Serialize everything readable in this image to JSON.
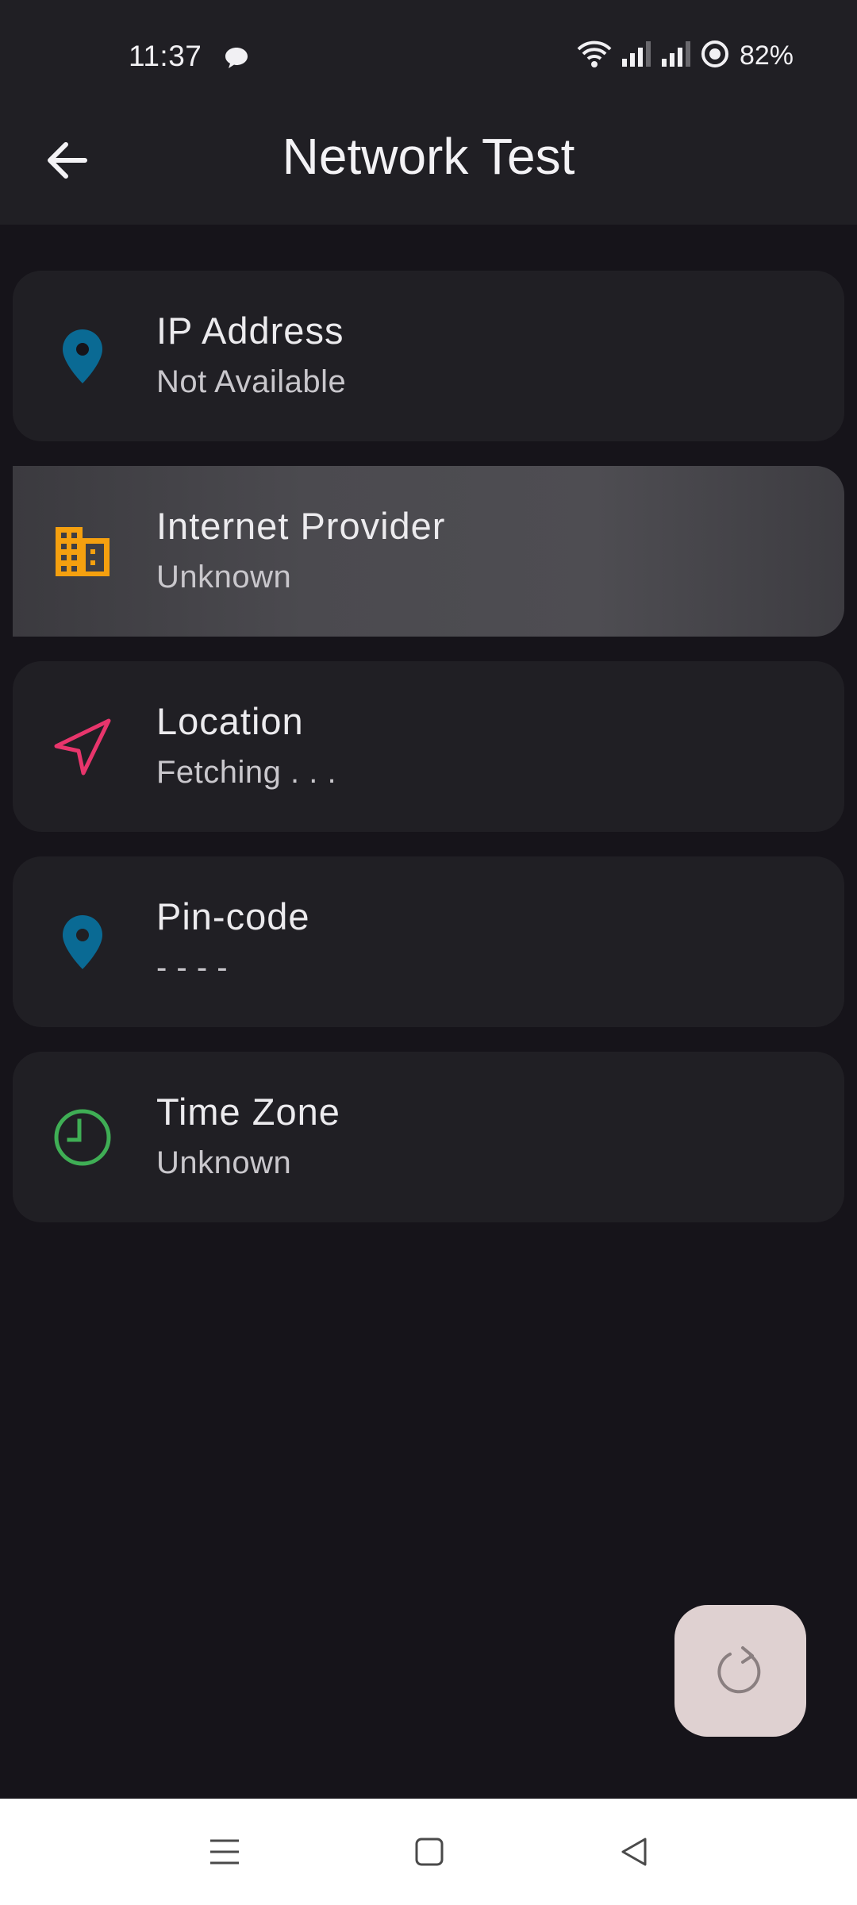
{
  "status_bar": {
    "time": "11:37",
    "battery_percent": "82%",
    "icons": [
      "chat-bubble-icon",
      "wifi-icon",
      "signal-icon",
      "signal-icon",
      "battery-ring-icon"
    ]
  },
  "app_bar": {
    "title": "Network Test",
    "back_icon": "arrow-left-icon"
  },
  "cards": [
    {
      "title": "IP Address",
      "value": "Not Available",
      "icon": "location-pin-icon",
      "icon_color": "#0a6a94"
    },
    {
      "title": "Internet Provider",
      "value": "Unknown",
      "icon": "building-icon",
      "icon_color": "#f5a00f",
      "state": "pressed"
    },
    {
      "title": "Location",
      "value": "Fetching . . .",
      "icon": "navigation-arrow-icon",
      "icon_color": "#e8356c"
    },
    {
      "title": "Pin-code",
      "value": "- - - -",
      "icon": "location-pin-icon",
      "icon_color": "#0a6a94"
    },
    {
      "title": "Time Zone",
      "value": "Unknown",
      "icon": "clock-icon",
      "icon_color": "#3fae55"
    }
  ],
  "fab": {
    "icon": "refresh-icon"
  },
  "nav_bar": {
    "icons": [
      "menu-icon",
      "home-square-icon",
      "back-triangle-icon"
    ]
  },
  "colors": {
    "background": "#16141a",
    "surface": "#201f24",
    "fab": "#dfd1d1"
  }
}
